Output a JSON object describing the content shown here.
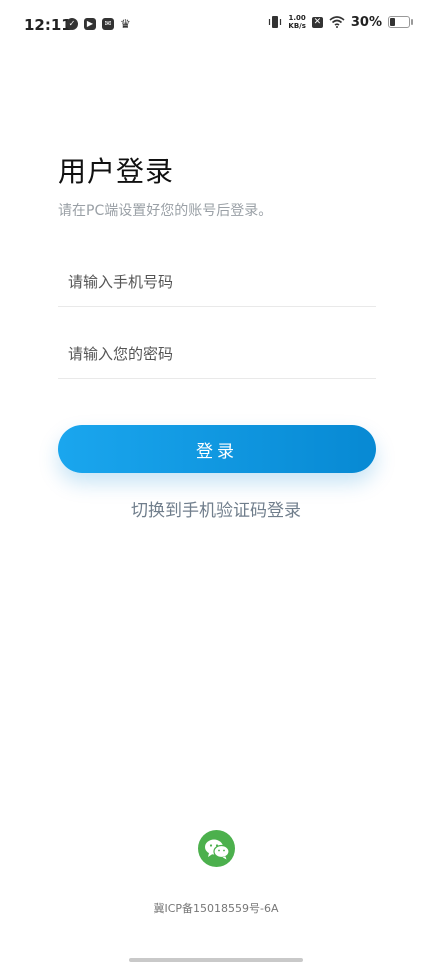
{
  "status_bar": {
    "time": "12:11",
    "net_speed_value": "1.00",
    "net_speed_unit": "KB/s",
    "battery_percent_text": "30%",
    "battery_level": 0.3
  },
  "header": {
    "title": "用户登录",
    "subtitle": "请在PC端设置好您的账号后登录。"
  },
  "form": {
    "phone_placeholder": "请输入手机号码",
    "password_placeholder": "请输入您的密码",
    "login_label": "登录",
    "switch_label": "切换到手机验证码登录"
  },
  "footer": {
    "icp": "冀ICP备15018559号-6A"
  },
  "colors": {
    "primary_start": "#1aa6ee",
    "primary_end": "#0789d3",
    "wechat_green": "#4cb04d"
  }
}
